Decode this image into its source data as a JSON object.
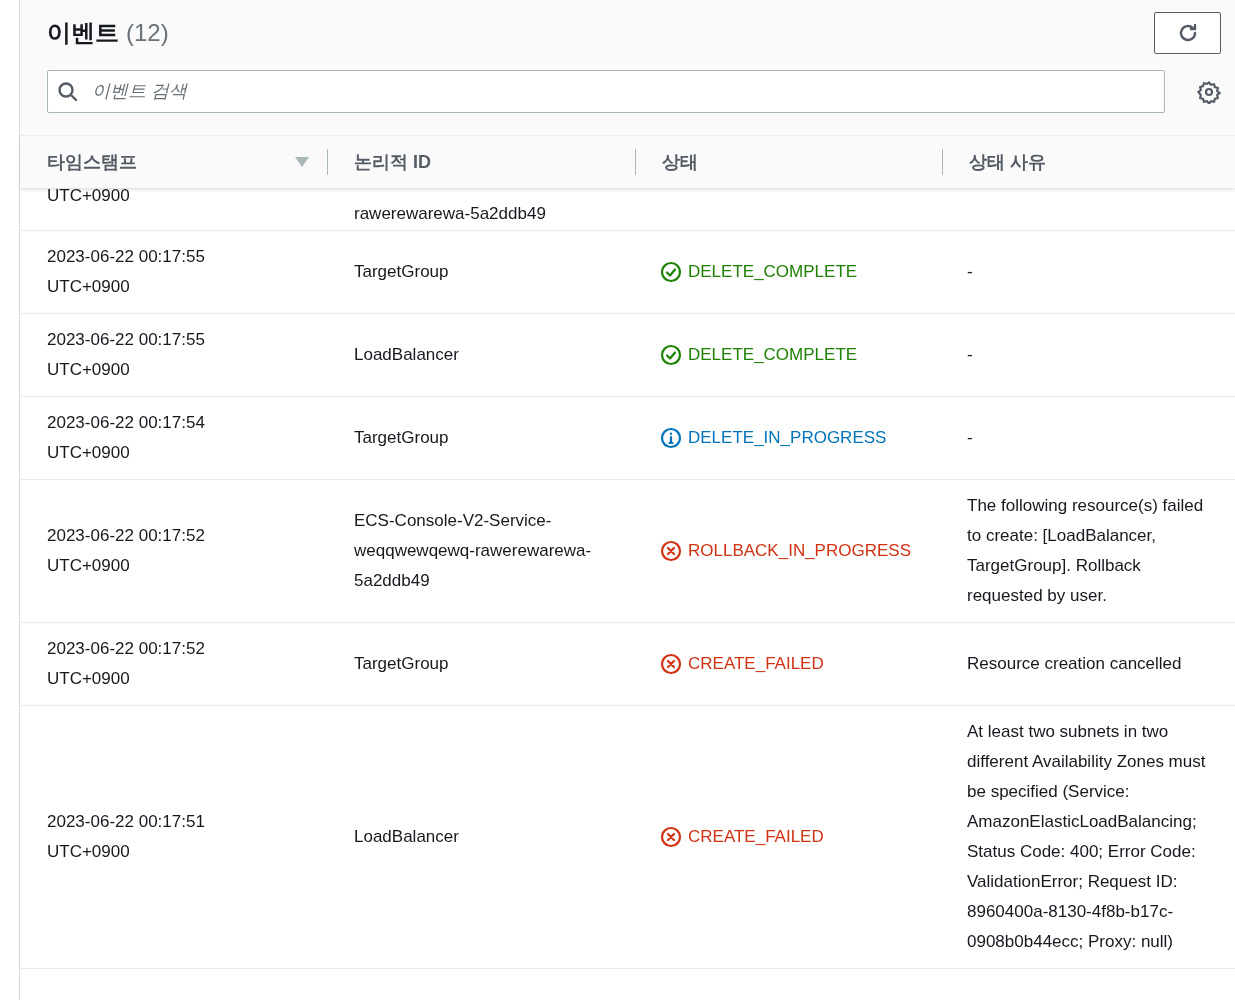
{
  "header": {
    "title": "이벤트",
    "count": "(12)"
  },
  "search": {
    "placeholder": "이벤트 검색"
  },
  "table": {
    "columns": [
      {
        "label": "타임스탬프",
        "sorted": true
      },
      {
        "label": "논리적 ID",
        "sorted": false
      },
      {
        "label": "상태",
        "sorted": false
      },
      {
        "label": "상태 사유",
        "sorted": false
      }
    ],
    "rows": [
      {
        "timestamp": [
          "UTC+0900"
        ],
        "logical_id": "rawerewarewa-5a2ddb49",
        "partial": true
      },
      {
        "timestamp": [
          "2023-06-22 00:17:55",
          "UTC+0900"
        ],
        "logical_id": "TargetGroup",
        "status": {
          "kind": "success",
          "label": "DELETE_COMPLETE"
        },
        "reason": "-"
      },
      {
        "timestamp": [
          "2023-06-22 00:17:55",
          "UTC+0900"
        ],
        "logical_id": "LoadBalancer",
        "status": {
          "kind": "success",
          "label": "DELETE_COMPLETE"
        },
        "reason": "-"
      },
      {
        "timestamp": [
          "2023-06-22 00:17:54",
          "UTC+0900"
        ],
        "logical_id": "TargetGroup",
        "status": {
          "kind": "info",
          "label": "DELETE_IN_PROGRESS"
        },
        "reason": "-"
      },
      {
        "timestamp": [
          "2023-06-22 00:17:52",
          "UTC+0900"
        ],
        "logical_id": "ECS-Console-V2-Service-weqqwewqewq-rawerewarewa-5a2ddb49",
        "status": {
          "kind": "error",
          "label": "ROLLBACK_IN_PROGRESS"
        },
        "reason": "The following resource(s) failed to create: [LoadBalancer, TargetGroup]. Rollback requested by user."
      },
      {
        "timestamp": [
          "2023-06-22 00:17:52",
          "UTC+0900"
        ],
        "logical_id": "TargetGroup",
        "status": {
          "kind": "error",
          "label": "CREATE_FAILED"
        },
        "reason": "Resource creation cancelled"
      },
      {
        "timestamp": [
          "2023-06-22 00:17:51",
          "UTC+0900"
        ],
        "logical_id": "LoadBalancer",
        "status": {
          "kind": "error",
          "label": "CREATE_FAILED"
        },
        "reason": "At least two subnets in two different Availability Zones must be specified (Service: AmazonElasticLoadBalancing; Status Code: 400; Error Code: ValidationError; Request ID: 8960400a-8130-4f8b-b17c-0908b0b44ecc; Proxy: null)"
      }
    ]
  }
}
